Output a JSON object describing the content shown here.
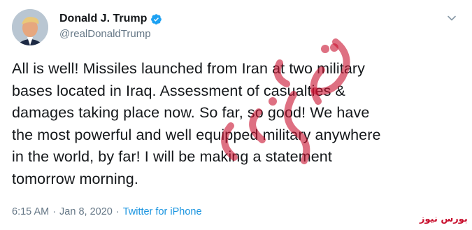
{
  "tweet": {
    "display_name": "Donald J. Trump",
    "handle": "@realDonaldTrump",
    "text": "All is well! Missiles launched from Iran at two military\nbases located in Iraq. Assessment of casualties &\ndamages taking place now. So far, so good! We have\nthe most powerful and well equipped military anywhere\nin the world, by far! I will be making a statement\ntomorrow morning.",
    "time": "6:15 AM",
    "separator": "·",
    "date": "Jan 8, 2020",
    "source": "Twitter for iPhone"
  },
  "watermark": {
    "logo_text": "بورس نیوز",
    "large_text": "بورس نیوز"
  },
  "icons": {
    "verified": "verified-badge-icon",
    "menu": "chevron-down-icon"
  },
  "colors": {
    "text": "#14171a",
    "secondary": "#657786",
    "link": "#1b95e0",
    "verified": "#1da1f2",
    "watermark": "#c8102e"
  }
}
